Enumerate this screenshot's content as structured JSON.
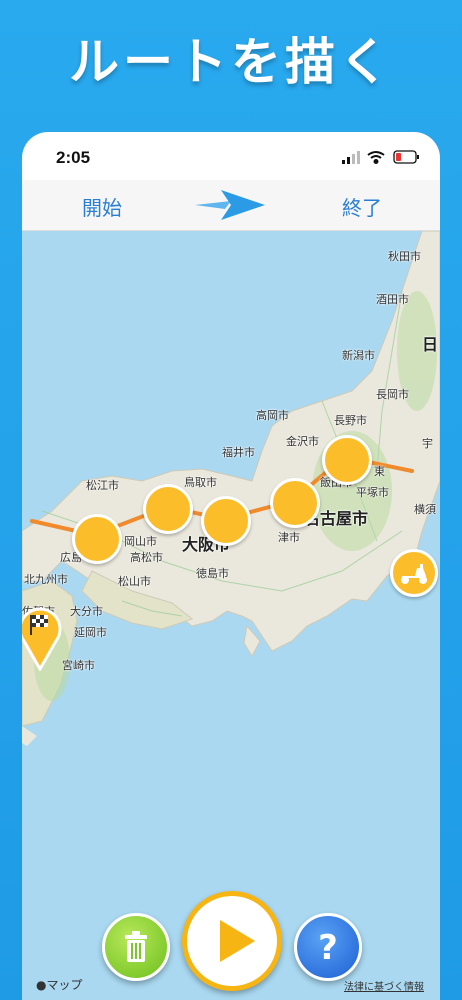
{
  "headline": "ルートを描く",
  "status": {
    "time": "2:05"
  },
  "nav": {
    "start_label": "開始",
    "end_label": "終了"
  },
  "colors": {
    "accent": "#2a7fd4",
    "stop": "#fbbd2a",
    "route": "#f08a2c",
    "background": "#29a9ee"
  },
  "map": {
    "region_label": "日",
    "cities": [
      {
        "name": "秋田市",
        "cls": "c-akita"
      },
      {
        "name": "酒田市",
        "cls": "c-sakata"
      },
      {
        "name": "新潟市",
        "cls": "c-niigata"
      },
      {
        "name": "長岡市",
        "cls": "c-nagaoka"
      },
      {
        "name": "高岡市",
        "cls": "c-takaoka"
      },
      {
        "name": "長野市",
        "cls": "c-nagano"
      },
      {
        "name": "福井市",
        "cls": "c-fukui"
      },
      {
        "name": "金沢市",
        "cls": "c-kanazawa"
      },
      {
        "name": "松江市",
        "cls": "c-matsue"
      },
      {
        "name": "鳥取市",
        "cls": "c-tottori"
      },
      {
        "name": "飯田市",
        "cls": "c-iida"
      },
      {
        "name": "平塚市",
        "cls": "c-hiratsuka"
      },
      {
        "name": "宇",
        "cls": "c-u"
      },
      {
        "name": "横須",
        "cls": "c-yokosuka"
      },
      {
        "name": "東",
        "cls": "c-higashi"
      },
      {
        "name": "広島",
        "cls": "c-hiroshima"
      },
      {
        "name": "岡山市",
        "cls": "c-okayama"
      },
      {
        "name": "高松市",
        "cls": "c-takamatsu"
      },
      {
        "name": "松山市",
        "cls": "c-matsuyama"
      },
      {
        "name": "徳島市",
        "cls": "c-tokushima"
      },
      {
        "name": "津市",
        "cls": "c-tsu"
      },
      {
        "name": "北九州市",
        "cls": "c-kitakyushu"
      },
      {
        "name": "佐賀市",
        "cls": "c-saga"
      },
      {
        "name": "大分市",
        "cls": "c-oita"
      },
      {
        "name": "延岡市",
        "cls": "c-nobeoka"
      },
      {
        "name": "宮崎市",
        "cls": "c-miyazaki"
      }
    ],
    "big_cities": {
      "osaka": "大阪市",
      "nagoya": "名古屋市"
    },
    "attribution": "マップ",
    "legal": "法律に基づく情報"
  },
  "icons": [
    "signal-icon",
    "wifi-icon",
    "battery-icon",
    "paper-plane-icon",
    "checkered-flag-pin-icon",
    "scooter-icon",
    "trash-icon",
    "play-icon",
    "question-icon",
    "apple-icon"
  ]
}
